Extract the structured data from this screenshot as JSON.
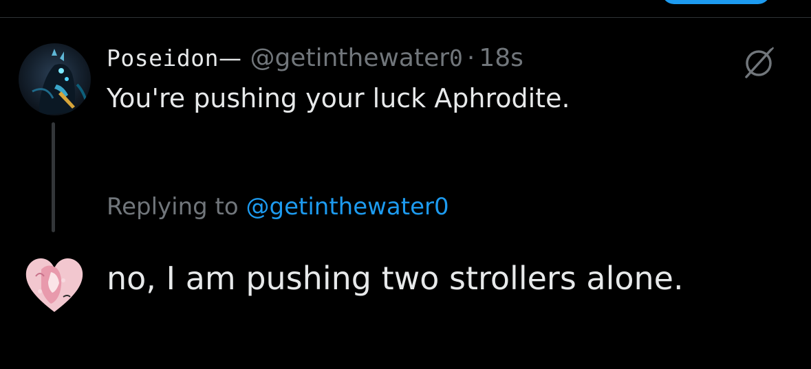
{
  "colors": {
    "background": "#000000",
    "text_primary": "#e7e9ea",
    "text_secondary": "#71767b",
    "accent": "#1d9bf0",
    "divider": "#2f3336"
  },
  "original_tweet": {
    "display_name": "Poseidon",
    "display_name_suffix": "—",
    "handle": "@getinthewater",
    "handle_suffix": "0",
    "separator": "·",
    "time": "18s",
    "text": "You're pushing your luck Aphrodite.",
    "avatar_icon": "poseidon-avatar",
    "action_icon": "grok-icon"
  },
  "reply_composer": {
    "replying_prefix": "Replying to ",
    "replying_mention": "@getinthewater0",
    "text": "no, I am pushing two strollers alone.",
    "avatar_icon": "aphrodite-avatar"
  }
}
